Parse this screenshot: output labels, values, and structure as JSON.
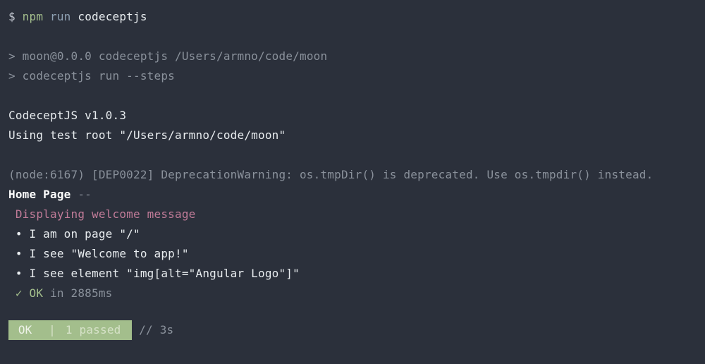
{
  "command_line": {
    "prompt": "$ ",
    "npm": "npm ",
    "run": "run ",
    "task": "codeceptjs"
  },
  "npm_header": {
    "line1_prefix": "> ",
    "line1": "moon@0.0.0 codeceptjs /Users/armno/code/moon",
    "line2_prefix": "> ",
    "line2": "codeceptjs run --steps"
  },
  "tool_info": {
    "version": "CodeceptJS v1.0.3",
    "root": "Using test root \"/Users/armno/code/moon\""
  },
  "warning": "(node:6167) [DEP0022] DeprecationWarning: os.tmpDir() is deprecated. Use os.tmpdir() instead.",
  "suite": {
    "name": "Home Page",
    "dash": " --"
  },
  "scenario": {
    "title": " Displaying welcome message",
    "steps": [
      " • I am on page \"/\"",
      " • I see \"Welcome to app!\"",
      " • I see element \"img[alt=\"Angular Logo\"]\""
    ]
  },
  "result": {
    "check": " ✓ ",
    "ok": "OK",
    "timing": " in 2885ms"
  },
  "footer": {
    "ok": " OK ",
    "sep": " | ",
    "passed": "1 passed ",
    "trailing_comment": " // ",
    "duration": "3s"
  }
}
